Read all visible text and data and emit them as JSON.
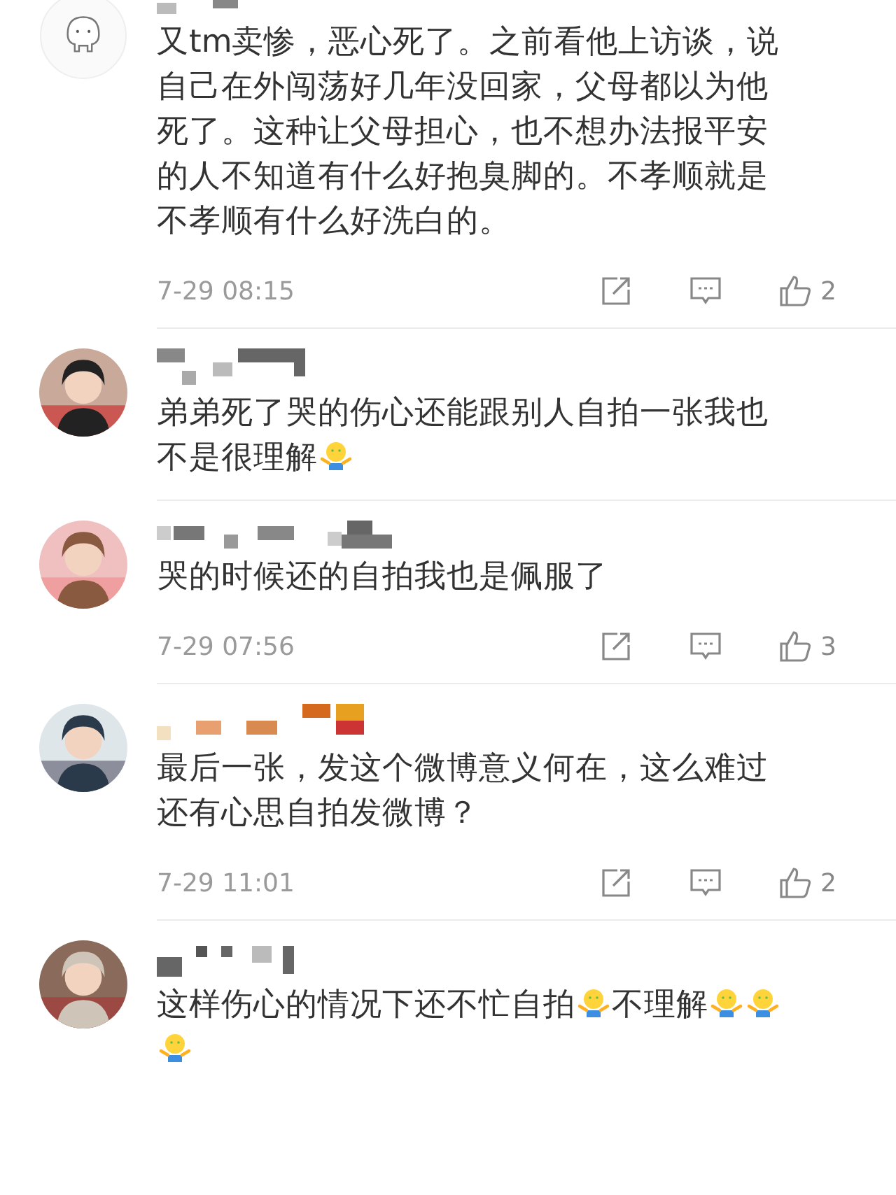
{
  "comments": [
    {
      "avatar": {
        "kind": "default"
      },
      "body": [
        {
          "kind": "text",
          "text": "又tm卖惨，恶心死了。之前看他上访谈，说自己在外闯荡好几年没回家，父母都以为他死了。这种让父母担心，也不想办法报平安的人不知道有什么好抱臭脚的。不孝顺就是不孝顺有什么好洗白的。"
        }
      ],
      "time": "7-29 08:15",
      "likes": "2"
    },
    {
      "body": [
        {
          "kind": "text",
          "text": "弟弟死了哭的伤心还能跟别人自拍一张我也"
        },
        {
          "kind": "text",
          "text": "不是很理解"
        },
        {
          "kind": "emoji"
        }
      ]
    },
    {
      "body": [
        {
          "kind": "text",
          "text": "哭的时候还的自拍我也是佩服了"
        }
      ],
      "time": "7-29 07:56",
      "likes": "3"
    },
    {
      "body": [
        {
          "kind": "text",
          "text": "最后一张，发这个微博意义何在，这么难过还有心思自拍发微博？"
        }
      ],
      "time": "7-29 11:01",
      "likes": "2"
    },
    {
      "body": [
        {
          "kind": "text",
          "text": "这样伤心的情况下还不忙自拍"
        },
        {
          "kind": "emoji"
        },
        {
          "kind": "text",
          "text": "不理解"
        },
        {
          "kind": "emoji"
        },
        {
          "kind": "emoji"
        },
        {
          "kind": "emoji"
        }
      ]
    }
  ]
}
